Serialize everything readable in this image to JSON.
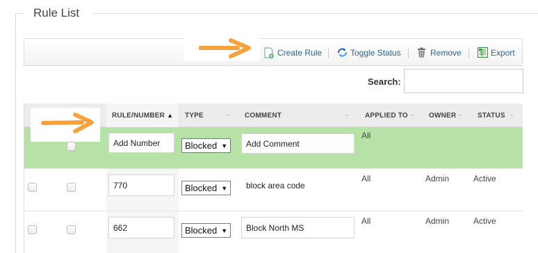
{
  "panel": {
    "title": "Rule List"
  },
  "toolbar": {
    "create_rule": "Create Rule",
    "toggle_status": "Toggle Status",
    "remove": "Remove",
    "export": "Export"
  },
  "search": {
    "label": "Search:",
    "value": ""
  },
  "columns": [
    "RULE/NUMBER",
    "TYPE",
    "COMMENT",
    "APPLIED TO",
    "OWNER",
    "STATUS"
  ],
  "sort": {
    "column": "RULE/NUMBER",
    "direction": "ascending"
  },
  "new_row": {
    "number_value": "Add Number",
    "type": "Blocked",
    "comment_value": "Add Comment",
    "applied_to": "All"
  },
  "rows": [
    {
      "number": "770",
      "type": "Blocked",
      "comment": "block area code",
      "applied_to": "All",
      "owner": "Admin",
      "status": "Active"
    },
    {
      "number": "662",
      "type": "Blocked",
      "comment": "Block North MS",
      "applied_to": "All",
      "owner": "Admin",
      "status": "Active"
    }
  ],
  "colors": {
    "new_row_bg": "#b7e2a7",
    "arrow": "#f5a23a",
    "link": "#2a6496"
  },
  "icons": [
    "create-rule-icon",
    "toggle-status-icon",
    "trash-icon",
    "export-icon",
    "sort-asc-icon",
    "chevron-down-icon",
    "annotation-arrow-icon"
  ]
}
